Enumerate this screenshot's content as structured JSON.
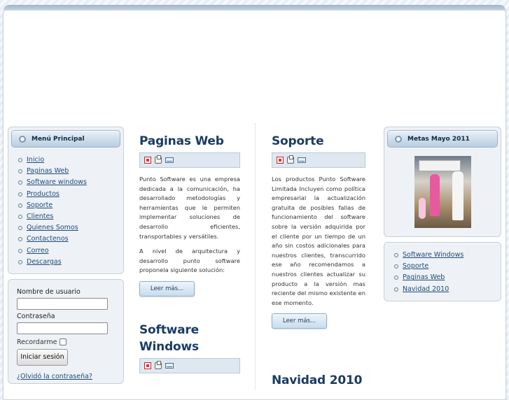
{
  "menu": {
    "title": "Menú Principal",
    "items": [
      "Inicio",
      "Paginas Web",
      "Software windows",
      "Productos",
      "Soporte",
      "Clientes",
      "Quienes Somos",
      "Contactenos",
      "Correo",
      "Descargas"
    ]
  },
  "login": {
    "username_label": "Nombre de usuario",
    "username_value": "",
    "password_label": "Contraseña",
    "password_value": "",
    "remember_label": "Recordarme",
    "submit_label": "Iniciar sesión",
    "forgot_label": "¿Olvidó la contraseña?"
  },
  "articles": {
    "paginas": {
      "title": "Paginas Web",
      "p1": "Punto Software es una empresa dedicada a la comunicación, ha desarrollado metodologías y herramientas que le permiten implementar soluciones de desarrollo eficientes, transportables y versátiles.",
      "p2": "A nivel de arquitectura y desarrollo punto software proponela siguiente solución:",
      "readmore": "Leer más..."
    },
    "software": {
      "title": "Software Windows"
    },
    "soporte": {
      "title": "Soporte",
      "p1": "Los productos Punto Software Limitada Incluyen como política empresarial la actualización gratuita de posibles fallas de funcionamiento del software sobre la versión adquirida por el cliente por un tiempo de un año sin costos adicionales para nuestros clientes, transcurrido ese año recomendamos a nuestros clientes actualizar su producto a la versión mas reciente del mismo existente en ese momento.",
      "readmore": "Leer más..."
    },
    "navidad": {
      "title": "Navidad 2010"
    }
  },
  "metas": {
    "title": "Metas Mayo 2011"
  },
  "right_links": [
    "Software Windows",
    "Soporte",
    "Paginas Web",
    "Navidad 2010"
  ],
  "icons": [
    "pdf-icon",
    "print-icon",
    "email-icon"
  ]
}
